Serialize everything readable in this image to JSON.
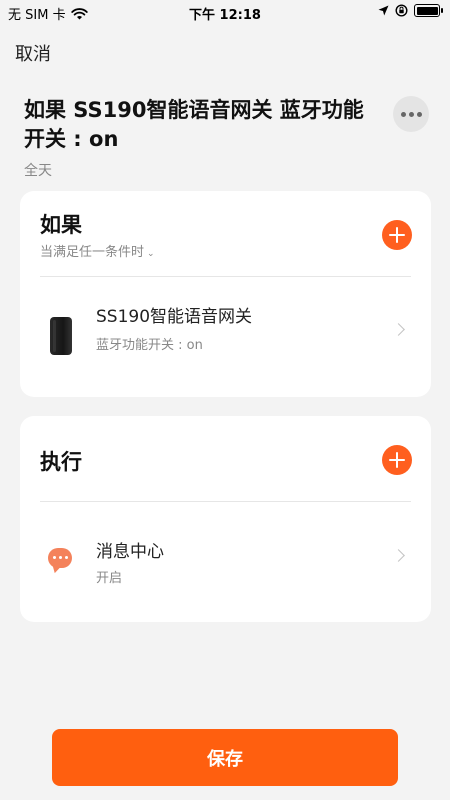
{
  "status_bar": {
    "carrier": "无 SIM 卡",
    "time": "下午 12:18"
  },
  "header": {
    "cancel_label": "取消",
    "title": "如果 SS190智能语音网关 蓝牙功能开关 : on",
    "subtitle": "全天"
  },
  "if_card": {
    "title": "如果",
    "condition_label": "当满足任一条件时",
    "condition_row": {
      "name": "SS190智能语音网关",
      "detail": "蓝牙功能开关 : on"
    }
  },
  "then_card": {
    "title": "执行",
    "action_row": {
      "name": "消息中心",
      "detail": "开启"
    }
  },
  "footer": {
    "save_label": "保存"
  },
  "colors": {
    "accent": "#ff5f1f",
    "background": "#f3f3f3",
    "card": "#ffffff",
    "secondary_text": "#888888"
  },
  "icons": {
    "wifi": "wifi-icon",
    "location": "location-arrow-icon",
    "lock_rotation": "rotation-lock-icon",
    "battery": "battery-icon",
    "more": "more-dots-icon",
    "add": "plus-circle-icon",
    "device": "gateway-device-icon",
    "message": "message-bubble-icon",
    "chevron": "chevron-right-icon"
  }
}
